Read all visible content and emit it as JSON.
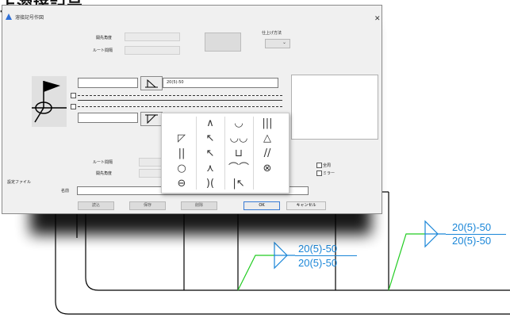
{
  "heading": {
    "text": "上溶接記号"
  },
  "drawing": {
    "callout_right": {
      "top": "20(5)-50",
      "bottom": "20(5)-50"
    },
    "callout_left": {
      "top": "20(5)-50",
      "bottom": "20(5)-50"
    },
    "callout_color": "#1a86d8",
    "leader_color": "#22cc22"
  },
  "dialog": {
    "title": "溶接記号作図",
    "close_icon": "close-icon",
    "upper": {
      "angle_label": "開先角度",
      "root_label": "ルート間隔"
    },
    "finish_label": "仕上げ方法",
    "upper_spec": "20(5)-50",
    "lower": {
      "root_label": "ルート間隔",
      "angle_label": "開先角度"
    },
    "checkboxes": {
      "full_circle": "全周",
      "mirror": "ミラー"
    },
    "settings_file_label": "設定ファイル",
    "name_label": "名前",
    "buttons": {
      "read": "読込",
      "save": "保存",
      "delete": "削除",
      "ok": "OK",
      "cancel": "キャンセル"
    }
  },
  "palette": {
    "symbols": [
      [
        "",
        "∧",
        "◡",
        "|||"
      ],
      [
        "◸",
        "↖",
        "◡◡",
        "△"
      ],
      [
        "||",
        "↖",
        "⊔",
        "//"
      ],
      [
        "○",
        "⋏",
        "⌒⌒",
        "⊗"
      ],
      [
        "⊖",
        ")(",
        "|↖",
        ""
      ]
    ]
  }
}
